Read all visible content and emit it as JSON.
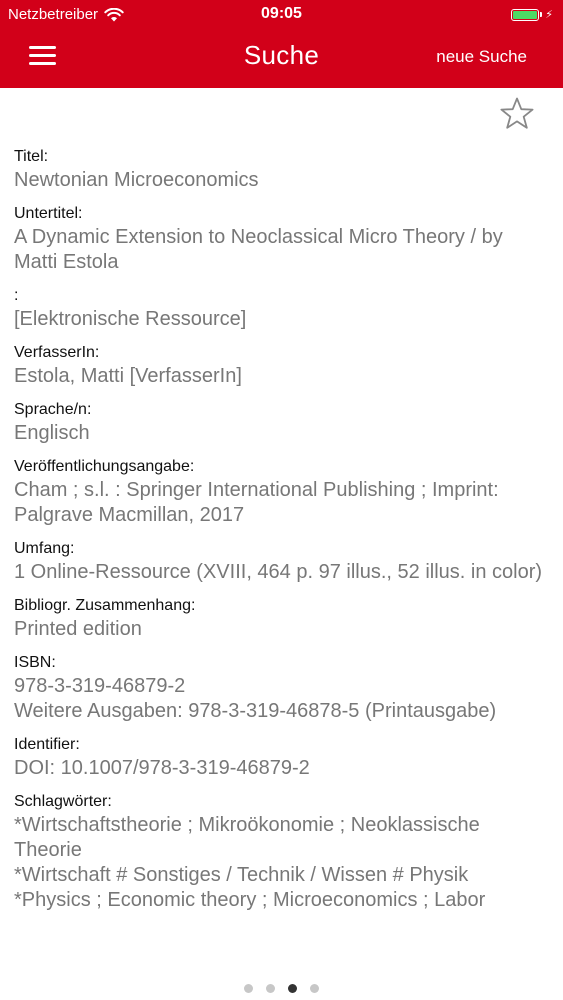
{
  "status_bar": {
    "carrier": "Netzbetreiber",
    "time": "09:05"
  },
  "nav": {
    "title": "Suche",
    "new_search_label": "neue Suche"
  },
  "icons": {
    "menu": "hamburger-menu-icon",
    "favorite": "star-outline-icon",
    "wifi": "wifi-icon",
    "battery": "battery-icon"
  },
  "colors": {
    "brand_red": "#d20019",
    "label": "#111111",
    "value": "#777777",
    "battery_green": "#4cd964"
  },
  "fields": [
    {
      "label": "Titel:",
      "lines": [
        "Newtonian Microeconomics"
      ]
    },
    {
      "label": "Untertitel:",
      "lines": [
        "A Dynamic Extension to Neoclassical Micro Theory / by Matti Estola"
      ]
    },
    {
      "label": ":",
      "lines": [
        "[Elektronische Ressource]"
      ]
    },
    {
      "label": "VerfasserIn:",
      "lines": [
        "Estola, Matti [VerfasserIn]"
      ]
    },
    {
      "label": "Sprache/n:",
      "lines": [
        "Englisch"
      ]
    },
    {
      "label": "Veröffentlichungsangabe:",
      "lines": [
        "Cham ; s.l. : Springer International Publishing ; Imprint: Palgrave Macmillan, 2017"
      ]
    },
    {
      "label": "Umfang:",
      "lines": [
        "1 Online-Ressource (XVIII, 464 p. 97 illus., 52 illus. in color)"
      ]
    },
    {
      "label": "Bibliogr. Zusammenhang:",
      "lines": [
        "Printed edition"
      ]
    },
    {
      "label": "ISBN:",
      "lines": [
        "978-3-319-46879-2",
        "Weitere Ausgaben: 978-3-319-46878-5 (Printausgabe)"
      ]
    },
    {
      "label": "Identifier:",
      "lines": [
        "DOI: 10.1007/978-3-319-46879-2"
      ]
    },
    {
      "label": "Schlagwörter:",
      "lines": [
        "*Wirtschaftstheorie ; Mikroökonomie ; Neoklassische Theorie",
        "*Wirtschaft # Sonstiges / Technik / Wissen # Physik",
        "*Physics ; Economic theory ; Microeconomics ; Labor"
      ]
    }
  ],
  "pager": {
    "count": 4,
    "active_index": 2
  }
}
